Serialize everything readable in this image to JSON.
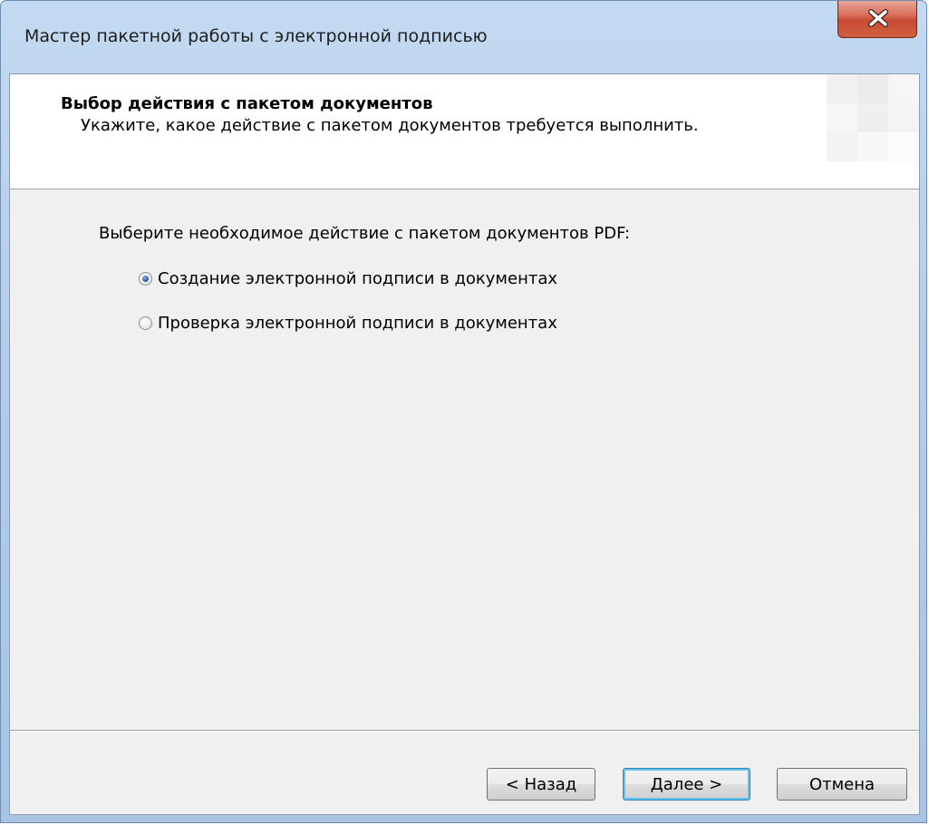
{
  "window": {
    "title": "Мастер пакетной работы с электронной подписью",
    "close_label": "x"
  },
  "header": {
    "title": "Выбор действия с пакетом документов",
    "subtitle": "Укажите, какое действие с пакетом документов требуется выполнить."
  },
  "body": {
    "prompt": "Выберите необходимое действие с пакетом документов PDF:",
    "options": [
      {
        "label": "Создание электронной подписи в документах",
        "checked": true
      },
      {
        "label": "Проверка электронной подписи в документах",
        "checked": false
      }
    ]
  },
  "buttons": {
    "back": "< Назад",
    "next": "Далее >",
    "cancel": "Отмена"
  },
  "colors": {
    "title_bar": "#b6cde8",
    "close_button": "#c74a33",
    "dialog_background": "#f0f0f0",
    "default_button_focus": "#5fc6f0"
  }
}
